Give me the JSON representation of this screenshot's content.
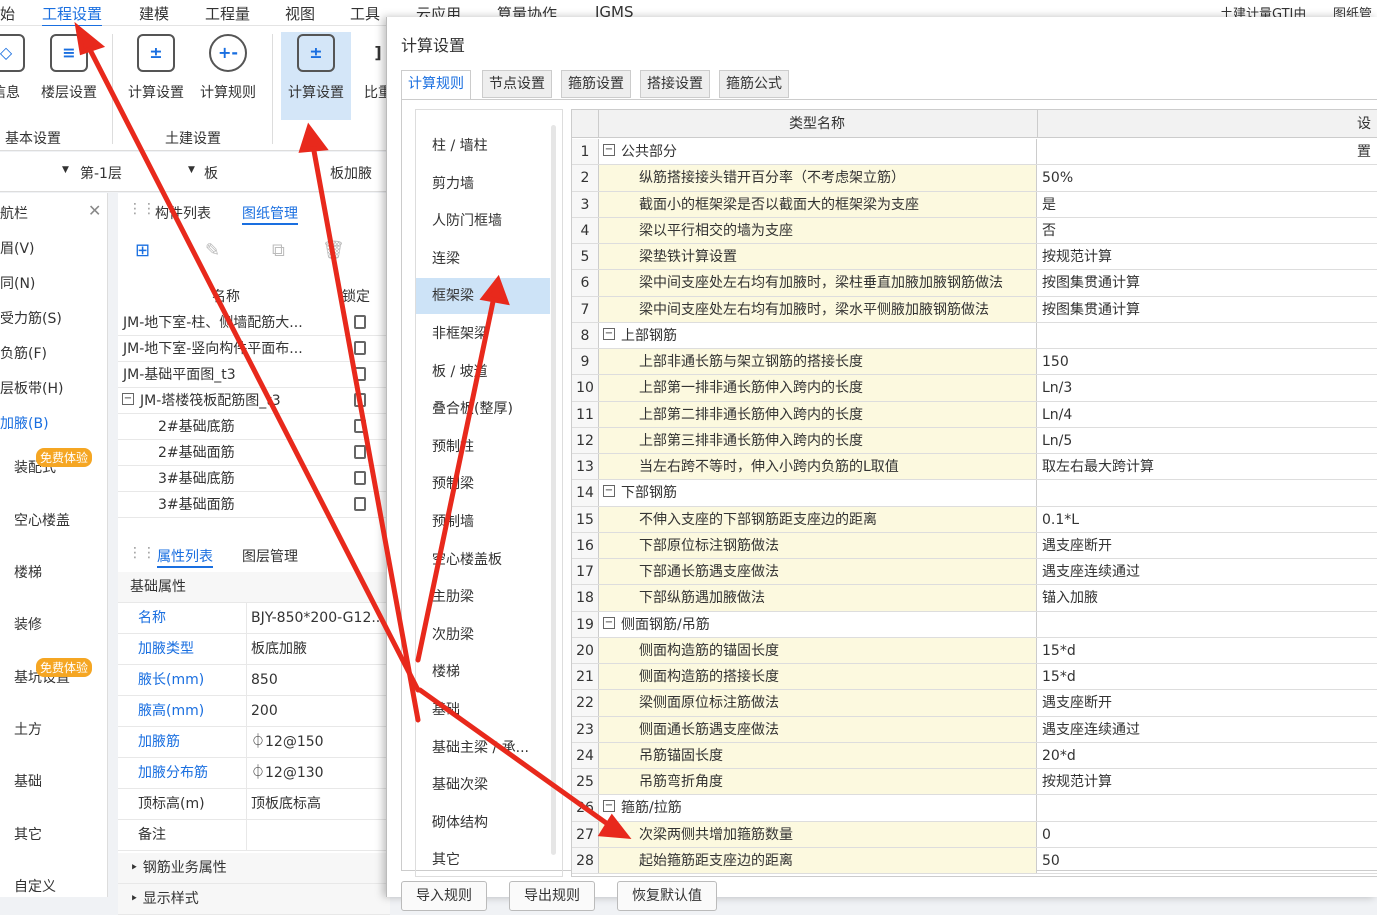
{
  "menubar": {
    "items": [
      "始",
      "工程设置",
      "建模",
      "工程量",
      "视图",
      "工具",
      "云应用",
      "算量协作",
      "IGMS"
    ],
    "right": "土建计量GTJ由",
    "right2": "图纸管"
  },
  "toolbar": {
    "tools": [
      "信息",
      "楼层设置",
      "计算设置",
      "计算规则",
      "计算设置",
      "比重"
    ],
    "groups": [
      "基本设置",
      "土建设置"
    ]
  },
  "selbar": {
    "floor": "第-1层",
    "type": "板",
    "item": "板加腋"
  },
  "nav": {
    "title": "航栏",
    "items": [
      "眉(V)",
      "同(N)",
      "受力筋(S)",
      "负筋(F)",
      "层板带(H)",
      "加腋(B)",
      "装配式",
      "空心楼盖",
      "楼梯",
      "装修",
      "基坑设置",
      "土方",
      "基础",
      "其它",
      "自定义"
    ],
    "badge": "免费体验"
  },
  "drawings": {
    "tabs": [
      "构件列表",
      "图纸管理"
    ],
    "col_name": "名称",
    "col_lock": "锁定",
    "rows": [
      "JM-地下室-柱、侧墙配筋大...",
      "JM-地下室-竖向构件平面布...",
      "JM-基础平面图_t3",
      "JM-塔楼筏板配筋图_t3",
      "2#基础底筋",
      "2#基础面筋",
      "3#基础底筋",
      "3#基础面筋"
    ]
  },
  "props": {
    "tabs": [
      "属性列表",
      "图层管理"
    ],
    "group": "基础属性",
    "rows": [
      {
        "k": "名称",
        "v": "BJY-850*200-G12..."
      },
      {
        "k": "加腋类型",
        "v": "板底加腋"
      },
      {
        "k": "腋长(mm)",
        "v": "850"
      },
      {
        "k": "腋高(mm)",
        "v": "200"
      },
      {
        "k": "加腋筋",
        "v": "⏀12@150"
      },
      {
        "k": "加腋分布筋",
        "v": "⏀12@130"
      },
      {
        "k": "顶标高(m)",
        "v": "顶板底标高"
      },
      {
        "k": "备注",
        "v": ""
      }
    ],
    "group2": "钢筋业务属性",
    "group3": "显示样式"
  },
  "dialog": {
    "title": "计算设置",
    "tabs": [
      "计算规则",
      "节点设置",
      "箍筋设置",
      "搭接设置",
      "箍筋公式"
    ],
    "categories": [
      "柱 / 墙柱",
      "剪力墙",
      "人防门框墙",
      "连梁",
      "框架梁",
      "非框架梁",
      "板 / 坡道",
      "叠合板(整厚)",
      "预制柱",
      "预制梁",
      "预制墙",
      "空心楼盖板",
      "主肋梁",
      "次肋梁",
      "楼梯",
      "基础",
      "基础主梁 / 承...",
      "基础次梁",
      "砌体结构",
      "其它"
    ],
    "grid_header": [
      "类型名称",
      "设置"
    ],
    "rows": [
      {
        "n": "1",
        "name": "公共部分",
        "val": "",
        "group": true
      },
      {
        "n": "2",
        "name": "纵筋搭接接头错开百分率（不考虑架立筋）",
        "val": "50%"
      },
      {
        "n": "3",
        "name": "截面小的框架梁是否以截面大的框架梁为支座",
        "val": "是"
      },
      {
        "n": "4",
        "name": "梁以平行相交的墙为支座",
        "val": "否"
      },
      {
        "n": "5",
        "name": "梁垫铁计算设置",
        "val": "按规范计算"
      },
      {
        "n": "6",
        "name": "梁中间支座处左右均有加腋时，梁柱垂直加腋加腋钢筋做法",
        "val": "按图集贯通计算"
      },
      {
        "n": "7",
        "name": "梁中间支座处左右均有加腋时，梁水平侧腋加腋钢筋做法",
        "val": "按图集贯通计算"
      },
      {
        "n": "8",
        "name": "上部钢筋",
        "val": "",
        "group": true
      },
      {
        "n": "9",
        "name": "上部非通长筋与架立钢筋的搭接长度",
        "val": "150"
      },
      {
        "n": "10",
        "name": "上部第一排非通长筋伸入跨内的长度",
        "val": "Ln/3"
      },
      {
        "n": "11",
        "name": "上部第二排非通长筋伸入跨内的长度",
        "val": "Ln/4"
      },
      {
        "n": "12",
        "name": "上部第三排非通长筋伸入跨内的长度",
        "val": "Ln/5"
      },
      {
        "n": "13",
        "name": "当左右跨不等时，伸入小跨内负筋的L取值",
        "val": "取左右最大跨计算"
      },
      {
        "n": "14",
        "name": "下部钢筋",
        "val": "",
        "group": true
      },
      {
        "n": "15",
        "name": "不伸入支座的下部钢筋距支座边的距离",
        "val": "0.1*L"
      },
      {
        "n": "16",
        "name": "下部原位标注钢筋做法",
        "val": "遇支座断开"
      },
      {
        "n": "17",
        "name": "下部通长筋遇支座做法",
        "val": "遇支座连续通过"
      },
      {
        "n": "18",
        "name": "下部纵筋遇加腋做法",
        "val": "锚入加腋"
      },
      {
        "n": "19",
        "name": "侧面钢筋/吊筋",
        "val": "",
        "group": true
      },
      {
        "n": "20",
        "name": "侧面构造筋的锚固长度",
        "val": "15*d"
      },
      {
        "n": "21",
        "name": "侧面构造筋的搭接长度",
        "val": "15*d"
      },
      {
        "n": "22",
        "name": "梁侧面原位标注筋做法",
        "val": "遇支座断开"
      },
      {
        "n": "23",
        "name": "侧面通长筋遇支座做法",
        "val": "遇支座连续通过"
      },
      {
        "n": "24",
        "name": "吊筋锚固长度",
        "val": "20*d"
      },
      {
        "n": "25",
        "name": "吊筋弯折角度",
        "val": "按规范计算"
      },
      {
        "n": "26",
        "name": "箍筋/拉筋",
        "val": "",
        "group": true
      },
      {
        "n": "27",
        "name": "次梁两侧共增加箍筋数量",
        "val": "0"
      },
      {
        "n": "28",
        "name": "起始箍筋距支座边的距离",
        "val": "50"
      }
    ],
    "buttons": [
      "导入规则",
      "导出规则",
      "恢复默认值"
    ]
  },
  "colors": {
    "accent": "#1a6fe0",
    "arrow": "#e8291c",
    "selected": "#cde3f7",
    "namecol": "#fcf9df"
  }
}
